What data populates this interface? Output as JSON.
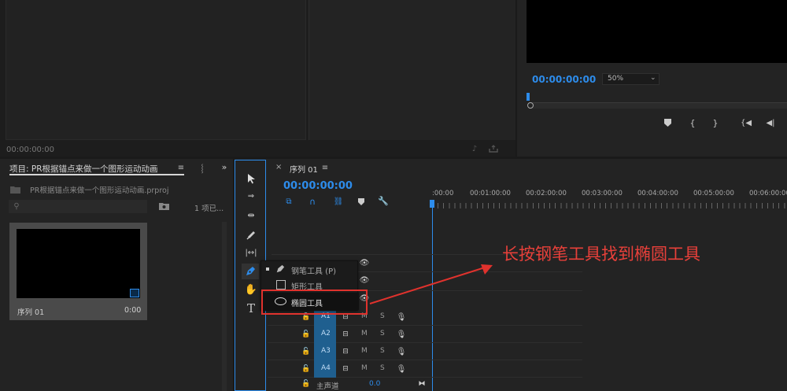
{
  "source_monitor": {
    "timecode": "00:00:00:00"
  },
  "program_monitor": {
    "timecode": "00:00:00:00",
    "zoom": "50%"
  },
  "project_panel": {
    "tab_title": "项目: PR根据锚点来做一个图形运动动画",
    "file_name": "PR根据锚点来做一个图形运动动画.prproj",
    "search_placeholder": "",
    "item_count": "1 项已...",
    "clip": {
      "name": "序列 01",
      "duration": "0:00"
    }
  },
  "tools_menu": {
    "items": [
      {
        "label": "钢笔工具 (P)"
      },
      {
        "label": "矩形工具"
      },
      {
        "label": "椭圆工具"
      }
    ]
  },
  "timeline": {
    "tab_close": "×",
    "tab_title": "序列 01",
    "timecode": "00:00:00:00",
    "ruler": [
      ":00:00",
      "00:01:00:00",
      "00:02:00:00",
      "00:03:00:00",
      "00:04:00:00",
      "00:05:00:00",
      "00:06:00:00"
    ],
    "audio_tracks": [
      {
        "name": "A1",
        "m": "M",
        "s": "S"
      },
      {
        "name": "A2",
        "m": "M",
        "s": "S"
      },
      {
        "name": "A3",
        "m": "M",
        "s": "S"
      },
      {
        "name": "A4",
        "m": "M",
        "s": "S"
      }
    ],
    "master": {
      "label": "主声道",
      "value": "0.0"
    }
  },
  "annotation": {
    "text": "长按钢笔工具找到椭圆工具",
    "color": "#e8403a"
  },
  "colors": {
    "accent": "#2d8ceb",
    "highlight_box": "#e0322d",
    "track_blue": "#1f5f8f"
  }
}
